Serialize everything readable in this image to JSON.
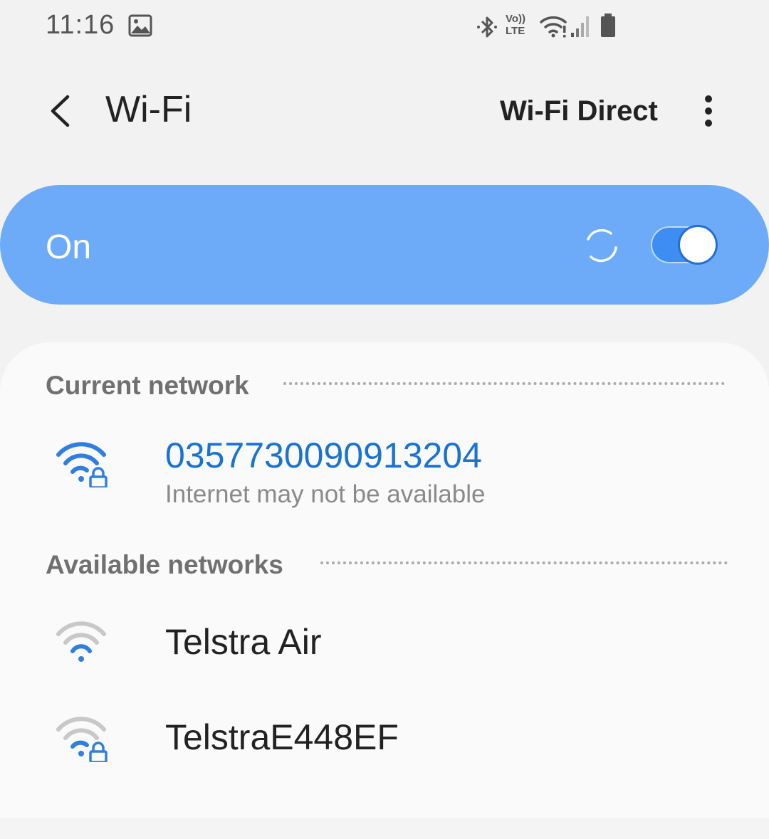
{
  "status_bar": {
    "time": "11:16",
    "icons": [
      "gallery-icon",
      "bluetooth-icon",
      "volte-icon",
      "wifi-status-icon",
      "cell-signal-icon",
      "battery-icon"
    ],
    "volte_top": "Vo))",
    "volte_bottom": "LTE"
  },
  "header": {
    "title": "Wi-Fi",
    "wifi_direct_label": "Wi-Fi Direct"
  },
  "toggle": {
    "label": "On",
    "state": "on",
    "accent_color": "#6dabf9"
  },
  "current_network": {
    "section_label": "Current network",
    "name": "0357730090913204",
    "status": "Internet may not be available",
    "name_color": "#1a73d2",
    "secured": true
  },
  "available_networks": {
    "section_label": "Available networks",
    "items": [
      {
        "name": "Telstra Air",
        "secured": false
      },
      {
        "name": "TelstraE448EF",
        "secured": true
      }
    ]
  }
}
